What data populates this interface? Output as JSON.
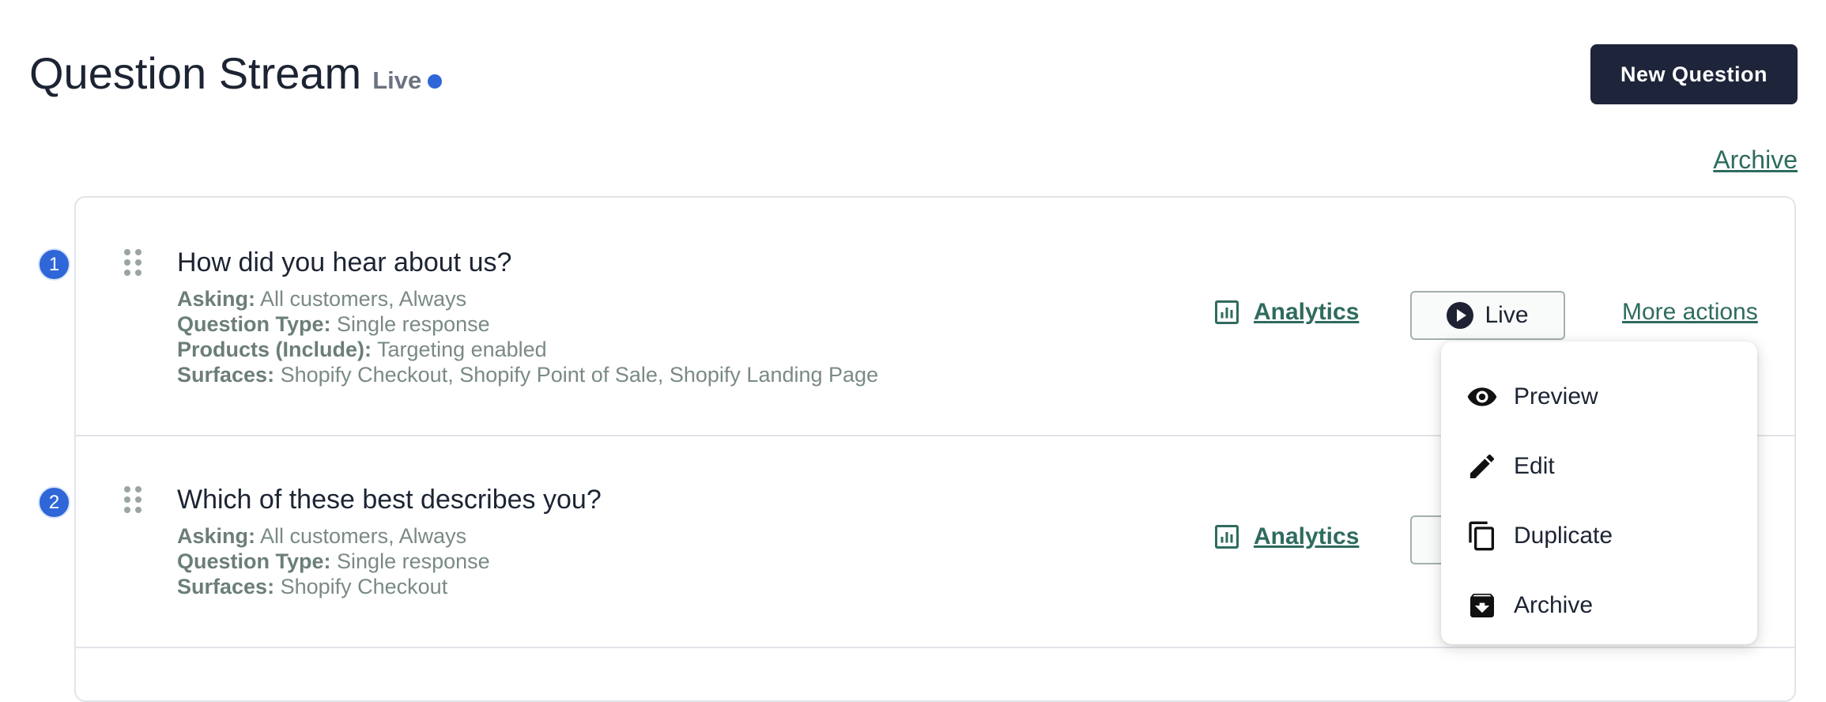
{
  "header": {
    "title": "Question Stream",
    "status": "Live",
    "new_question_label": "New Question",
    "archive_label": "Archive"
  },
  "questions": [
    {
      "number": "1",
      "title": "How did you hear about us?",
      "asking_label": "Asking:",
      "asking_value": "All customers, Always",
      "type_label": "Question Type:",
      "type_value": "Single response",
      "products_label": "Products (Include):",
      "products_value": "Targeting enabled",
      "surfaces_label": "Surfaces:",
      "surfaces_value": "Shopify Checkout, Shopify Point of Sale, Shopify Landing Page",
      "analytics_label": "Analytics",
      "status_label": "Live",
      "more_actions_label": "More actions"
    },
    {
      "number": "2",
      "title": "Which of these best describes you?",
      "asking_label": "Asking:",
      "asking_value": "All customers, Always",
      "type_label": "Question Type:",
      "type_value": "Single response",
      "surfaces_label": "Surfaces:",
      "surfaces_value": "Shopify Checkout",
      "analytics_label": "Analytics"
    }
  ],
  "menu": {
    "items": [
      {
        "label": "Preview",
        "icon": "eye-icon"
      },
      {
        "label": "Edit",
        "icon": "pencil-icon"
      },
      {
        "label": "Duplicate",
        "icon": "duplicate-icon"
      },
      {
        "label": "Archive",
        "icon": "archive-icon"
      }
    ]
  },
  "colors": {
    "accent": "#2f66d8",
    "link": "#2f6b5f",
    "primary_button": "#1e2439"
  }
}
